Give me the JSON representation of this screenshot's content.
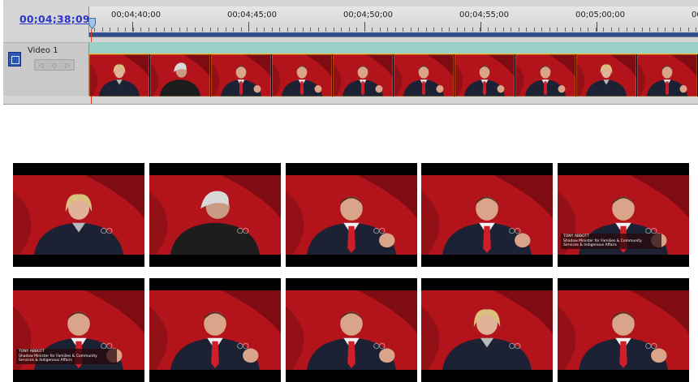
{
  "timeline": {
    "timecode": "00;04;38;09",
    "ruler_labels": [
      "00;04;40;00",
      "00;04;45;00",
      "00;04;50;00",
      "00;04;55;00",
      "00;05;00;00",
      "00;0"
    ],
    "track": {
      "name": "Video 1",
      "nav_glyphs": [
        "◁",
        "◇",
        "▷"
      ]
    },
    "clip_frames": [
      {
        "subject": "woman"
      },
      {
        "subject": "grey-haired man"
      },
      {
        "subject": "man"
      },
      {
        "subject": "man"
      },
      {
        "subject": "man"
      },
      {
        "subject": "man"
      },
      {
        "subject": "man"
      },
      {
        "subject": "man"
      },
      {
        "subject": "woman"
      },
      {
        "subject": "man"
      }
    ]
  },
  "thumbnails": [
    {
      "subject": "woman",
      "caption_lines": []
    },
    {
      "subject": "grey-haired man",
      "caption_lines": []
    },
    {
      "subject": "man",
      "caption_lines": []
    },
    {
      "subject": "man",
      "caption_lines": []
    },
    {
      "subject": "man",
      "caption_lines": [
        "TONY ABBOTT",
        "Shadow Minister for Families & Community",
        "Services & Indigenous Affairs"
      ]
    },
    {
      "subject": "man",
      "caption_lines": [
        "TONY ABBOTT",
        "Shadow Minister for Families & Community",
        "Services & Indigenous Affairs"
      ]
    },
    {
      "subject": "man",
      "caption_lines": []
    },
    {
      "subject": "man",
      "caption_lines": []
    },
    {
      "subject": "woman",
      "caption_lines": []
    },
    {
      "subject": "man",
      "caption_lines": []
    }
  ],
  "colors": {
    "timecode": "#2a36c8",
    "track_lane": "#aad8d2",
    "work_bar": "#2f4f8f",
    "playhead": "#e23a2a",
    "studio_red": "#b3141c",
    "suit": "#1c2234",
    "tie": "#d01d2a"
  }
}
